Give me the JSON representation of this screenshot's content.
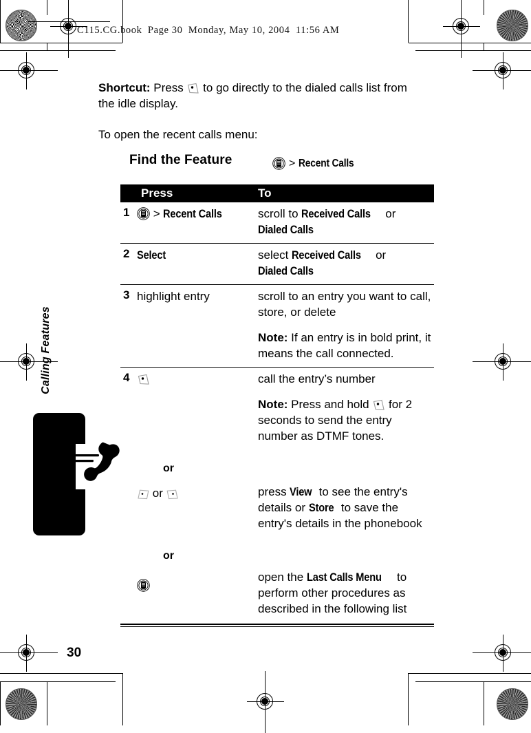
{
  "document": {
    "running_header": "C115.CG.book  Page 30  Monday, May 10, 2004  11:56 AM",
    "page_number": "30",
    "side_tab_label": "Calling Features"
  },
  "body": {
    "shortcut": {
      "lead": "Shortcut:",
      "text_before_icon": " Press ",
      "icon": "send-key-icon",
      "text_after_icon": " to go directly to the dialed calls list from the idle display."
    },
    "intro": "To open the recent calls menu:"
  },
  "find_the_feature": {
    "label": "Find the Feature",
    "icon": "menu-key-icon",
    "separator": ">",
    "target": "Recent Calls"
  },
  "table": {
    "headers": {
      "press": "Press",
      "to": "To"
    },
    "rows": [
      {
        "num": "1",
        "press_icon": "menu-key-icon",
        "press_sep": ">",
        "press_target": "Recent Calls",
        "to_parts": [
          {
            "t": "scroll to ",
            "style": "normal"
          },
          {
            "t": "Received Calls",
            "style": "display"
          },
          {
            "t": " or ",
            "style": "normal"
          },
          {
            "t": "Dialed Calls",
            "style": "display"
          }
        ]
      },
      {
        "num": "2",
        "press_label": "Select",
        "to_parts": [
          {
            "t": "select ",
            "style": "normal"
          },
          {
            "t": "Received Calls",
            "style": "display"
          },
          {
            "t": " or ",
            "style": "normal"
          },
          {
            "t": "Dialed Calls",
            "style": "display"
          }
        ]
      },
      {
        "num": "3",
        "press_label": "highlight entry",
        "to_line1": "scroll to an entry you want to call, store, or delete",
        "note_label": "Note:",
        "note_text": " If an entry is in bold print, it means the call connected."
      },
      {
        "num": "4",
        "press_icon": "send-key-icon",
        "to_line1": "call the entry’s number",
        "note_label": "Note:",
        "note_before": " Press and hold ",
        "note_icon": "send-key-icon",
        "note_after": " for 2 seconds to send the entry number as DTMF tones."
      }
    ],
    "alt_blocks": [
      {
        "or_word": "or",
        "press_icons": [
          "soft-key-left-icon",
          "soft-key-right-icon"
        ],
        "press_joiner": "or",
        "to_parts": [
          {
            "t": "press ",
            "style": "normal"
          },
          {
            "t": "View",
            "style": "display"
          },
          {
            "t": " to see the entry's details or ",
            "style": "normal"
          },
          {
            "t": "Store",
            "style": "display"
          },
          {
            "t": " to save the entry's details in the phonebook",
            "style": "normal"
          }
        ]
      },
      {
        "or_word": "or",
        "press_icons": [
          "menu-key-icon"
        ],
        "to_parts": [
          {
            "t": "open the ",
            "style": "normal"
          },
          {
            "t": "Last Calls Menu",
            "style": "display"
          },
          {
            "t": " to perform other procedures as described in the following list",
            "style": "normal"
          }
        ]
      }
    ]
  },
  "print_marks": {
    "registration": "crosshair-registration-icon",
    "color_target": "starburst-density-target-icon"
  }
}
